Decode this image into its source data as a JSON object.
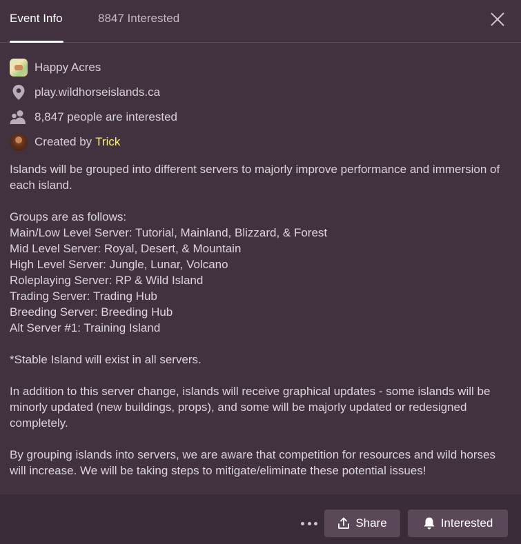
{
  "tabs": {
    "event_info": "Event Info",
    "interested": "8847 Interested"
  },
  "meta": {
    "server_name": "Happy Acres",
    "location": "play.wildhorseislands.ca",
    "interested_text": "8,847 people are interested",
    "created_by_label": "Created by",
    "creator_name": "Trick"
  },
  "description": {
    "intro": "Islands will be grouped into different servers to majorly improve performance and immersion of each island.",
    "groups_heading": "Groups are as follows:",
    "groups": [
      "Main/Low Level Server: Tutorial, Mainland, Blizzard, & Forest",
      "Mid Level Server: Royal, Desert, & Mountain",
      "High Level Server: Jungle, Lunar, Volcano",
      "Roleplaying Server: RP & Wild Island",
      "Trading Server: Trading Hub",
      "Breeding Server: Breeding Hub",
      "Alt Server #1: Training Island"
    ],
    "note": "*Stable Island will exist in all servers.",
    "updates": "In addition to this server change, islands will receive graphical updates - some islands will be minorly updated (new buildings, props), and some will be majorly updated or redesigned completely.",
    "closing": "By grouping islands into servers, we are aware that competition for resources and wild horses will increase. We will be taking steps to mitigate/eliminate these potential issues!"
  },
  "footer": {
    "share_label": "Share",
    "interested_label": "Interested"
  },
  "colors": {
    "background": "#42313f",
    "footer": "#3a2b38",
    "button": "#5a4758",
    "creator_highlight": "#fff36c"
  }
}
